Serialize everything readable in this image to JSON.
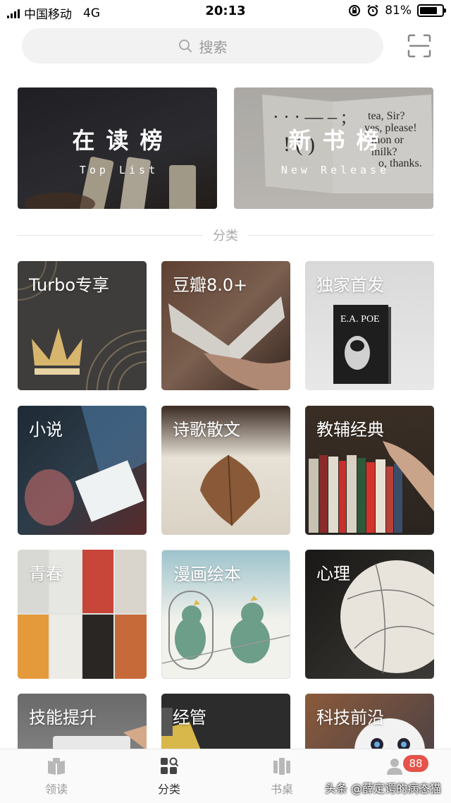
{
  "status_bar": {
    "carrier": "中国移动",
    "network": "4G",
    "time": "20:13",
    "battery": "81%",
    "battery_level": 0.81
  },
  "search": {
    "placeholder": "搜索",
    "icon": "search-icon",
    "scan_icon": "scan-icon"
  },
  "banners": [
    {
      "title": "在读榜",
      "subtitle": "Top List"
    },
    {
      "title": "新书榜",
      "subtitle": "New Release"
    }
  ],
  "section_title": "分类",
  "categories": [
    {
      "label": "Turbo专享"
    },
    {
      "label": "豆瓣8.0+"
    },
    {
      "label": "独家首发"
    },
    {
      "label": "小说"
    },
    {
      "label": "诗歌散文"
    },
    {
      "label": "教辅经典"
    },
    {
      "label": "青春"
    },
    {
      "label": "漫画绘本"
    },
    {
      "label": "心理"
    },
    {
      "label": "技能提升"
    },
    {
      "label": "经管"
    },
    {
      "label": "科技前沿"
    }
  ],
  "book_cover": {
    "author": "E.A. POE"
  },
  "tab_bar": {
    "tabs": [
      {
        "label": "领读",
        "icon": "book-open-icon"
      },
      {
        "label": "分类",
        "icon": "category-icon"
      },
      {
        "label": "书桌",
        "icon": "bookshelf-icon"
      },
      {
        "label": "",
        "icon": "profile-icon"
      }
    ],
    "active_index": 1,
    "badge": "88"
  },
  "watermark": "头条 @薛定谔的病态猫",
  "colors": {
    "badge": "#e5534b",
    "tab_active": "#333333",
    "tab_inactive": "#999999",
    "search_bg": "#f2f2f2"
  }
}
